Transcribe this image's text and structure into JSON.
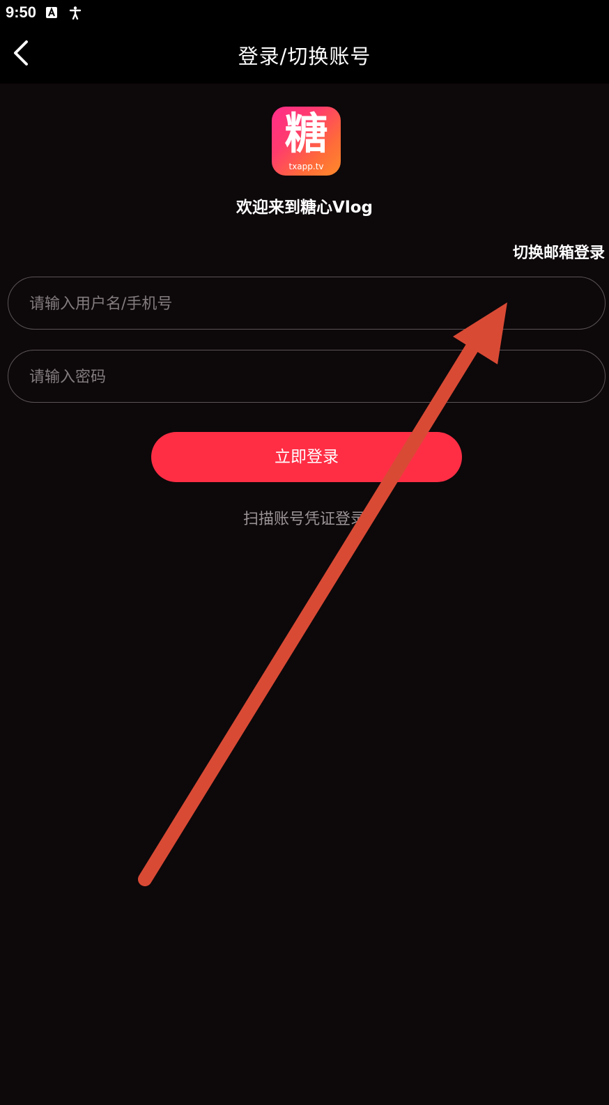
{
  "status_bar": {
    "time": "9:50",
    "icons": [
      "font-a-icon",
      "accessibility-icon"
    ]
  },
  "header": {
    "title": "登录/切换账号",
    "back_icon": "chevron-left-icon"
  },
  "logo": {
    "glyph": "糖",
    "subtitle": "txapp.tv"
  },
  "welcome": "欢迎来到糖心Vlog",
  "switch_email_label": "切换邮箱登录",
  "form": {
    "username_placeholder": "请输入用户名/手机号",
    "username_value": "",
    "password_placeholder": "请输入密码",
    "password_value": ""
  },
  "login_button_label": "立即登录",
  "scan_login_label": "扫描账号凭证登录",
  "colors": {
    "background": "#0d080a",
    "bar_background": "#000000",
    "primary_button": "#ff2e45",
    "input_border": "#5c5557",
    "placeholder_text": "#837c7e",
    "annotation_arrow": "#d94a35"
  }
}
